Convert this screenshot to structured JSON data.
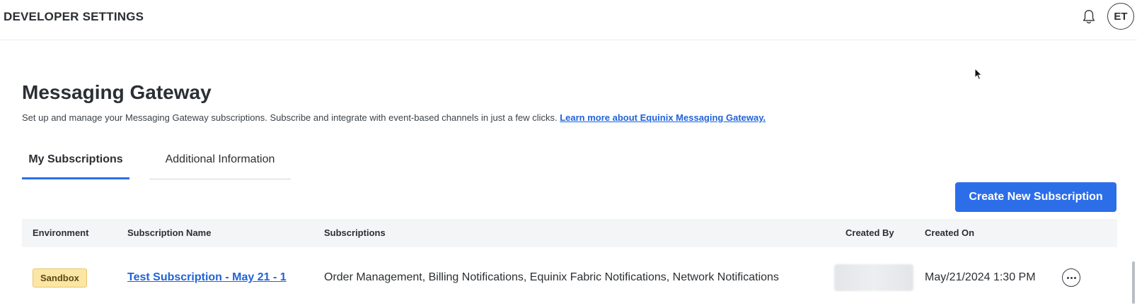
{
  "header": {
    "app_title": "DEVELOPER SETTINGS",
    "avatar_initials": "ET",
    "bell_icon": "bell-icon"
  },
  "page": {
    "title": "Messaging Gateway",
    "description": "Set up and manage your Messaging Gateway subscriptions. Subscribe and integrate with event-based channels in just a few clicks.",
    "learn_more_link": "Learn more about Equinix Messaging Gateway."
  },
  "tabs": [
    {
      "label": "My Subscriptions",
      "active": true
    },
    {
      "label": "Additional Information",
      "active": false
    }
  ],
  "actions": {
    "create_button": "Create New Subscription"
  },
  "table": {
    "columns": [
      "Environment",
      "Subscription Name",
      "Subscriptions",
      "Created By",
      "Created On"
    ],
    "rows": [
      {
        "environment": "Sandbox",
        "subscription_name": "Test Subscription - May 21 - 1",
        "subscriptions": "Order Management, Billing Notifications, Equinix Fabric Notifications, Network Notifications",
        "created_on": "May/21/2024 1:30 PM",
        "actions_icon": "more-horizontal-icon"
      }
    ]
  },
  "colors": {
    "accent": "#2c6ee8",
    "link": "#1f63d8",
    "badge_bg": "#fbe6a6",
    "header_row_bg": "#f4f5f7"
  }
}
